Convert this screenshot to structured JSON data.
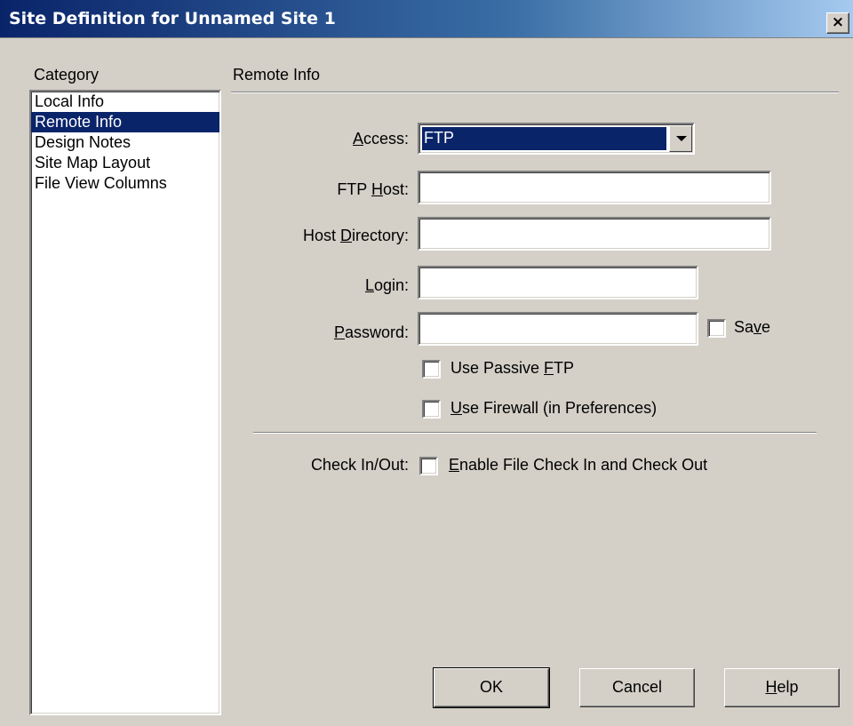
{
  "window": {
    "title": "Site Definition for Unnamed Site 1",
    "close_label": "×"
  },
  "category": {
    "label": "Category",
    "items": [
      {
        "label": "Local Info",
        "selected": false
      },
      {
        "label": "Remote Info",
        "selected": true
      },
      {
        "label": "Design Notes",
        "selected": false
      },
      {
        "label": "Site Map Layout",
        "selected": false
      },
      {
        "label": "File View Columns",
        "selected": false
      }
    ]
  },
  "panel": {
    "title": "Remote Info",
    "access": {
      "label": "Access:",
      "value": "FTP"
    },
    "ftp_host": {
      "label": "FTP Host:",
      "value": ""
    },
    "host_directory": {
      "label": "Host Directory:",
      "value": ""
    },
    "login": {
      "label": "Login:",
      "value": ""
    },
    "password": {
      "label": "Password:",
      "value": "",
      "save_label": "Save",
      "save_checked": false
    },
    "passive_ftp": {
      "label": "Use Passive FTP",
      "checked": false
    },
    "firewall": {
      "label": "Use Firewall (in Preferences)",
      "checked": false
    },
    "checkinout": {
      "label": "Check In/Out:",
      "option_label": "Enable File Check In and Check Out",
      "checked": false
    }
  },
  "buttons": {
    "ok": "OK",
    "cancel": "Cancel",
    "help": "Help"
  },
  "colors": {
    "selection": "#0a246a",
    "face": "#d4d0c8",
    "title_start": "#0a246a",
    "title_end": "#a6caf0"
  }
}
